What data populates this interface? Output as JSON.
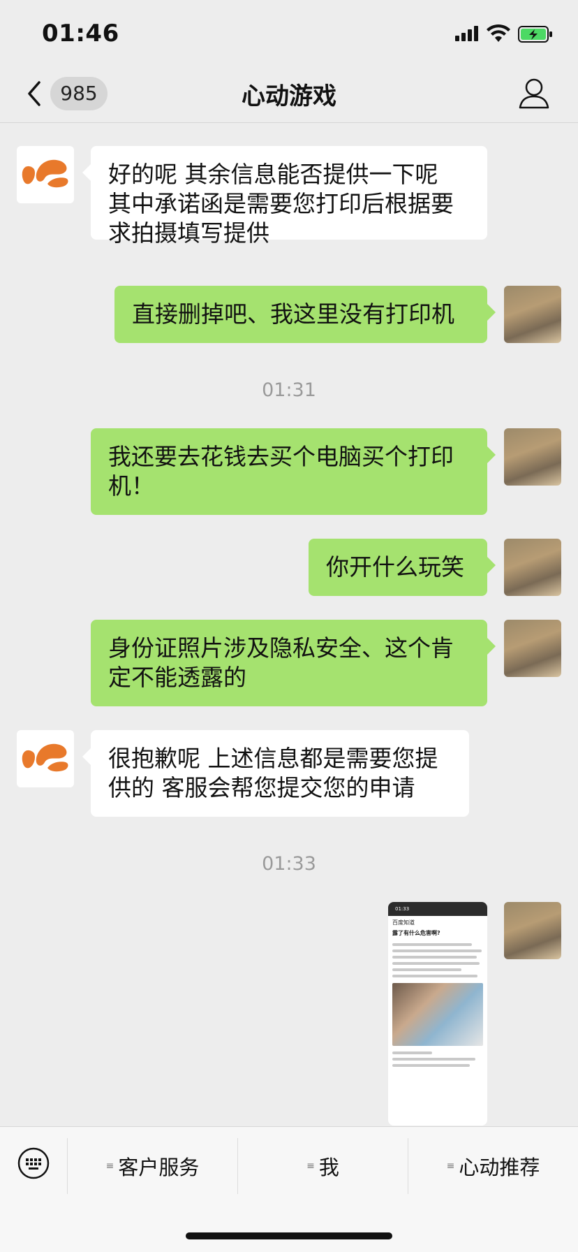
{
  "status_bar": {
    "time": "01:46"
  },
  "nav": {
    "unread_count": "985",
    "title": "心动游戏"
  },
  "messages": [
    {
      "side": "in",
      "text": "好的呢 其余信息能否提供一下呢\n其中承诺函是需要您打印后根据要\n求拍摄填写提供"
    },
    {
      "side": "out",
      "text": "直接删掉吧、我这里没有打印机"
    },
    {
      "side": "out",
      "text": "我还要去花钱去买个电脑买个打印\n机！"
    },
    {
      "side": "out",
      "text": "你开什么玩笑"
    },
    {
      "side": "out",
      "text": "身份证照片涉及隐私安全、这个肯\n定不能透露的"
    },
    {
      "side": "in",
      "text": "很抱歉呢 上述信息都是需要您提\n供的 客服会帮您提交您的申请"
    }
  ],
  "timestamps": [
    "01:31",
    "01:33"
  ],
  "image_message": {
    "time": "01:33",
    "site": "百度知道",
    "question": "露了有什么危害啊?"
  },
  "bottom_menu": {
    "items": [
      {
        "label": "客户服务"
      },
      {
        "label": "我"
      },
      {
        "label": "心动推荐"
      }
    ]
  },
  "colors": {
    "outgoing_bubble": "#a5e26f",
    "incoming_bubble": "#ffffff",
    "background": "#ededed",
    "bot_logo": "#e8792b"
  }
}
